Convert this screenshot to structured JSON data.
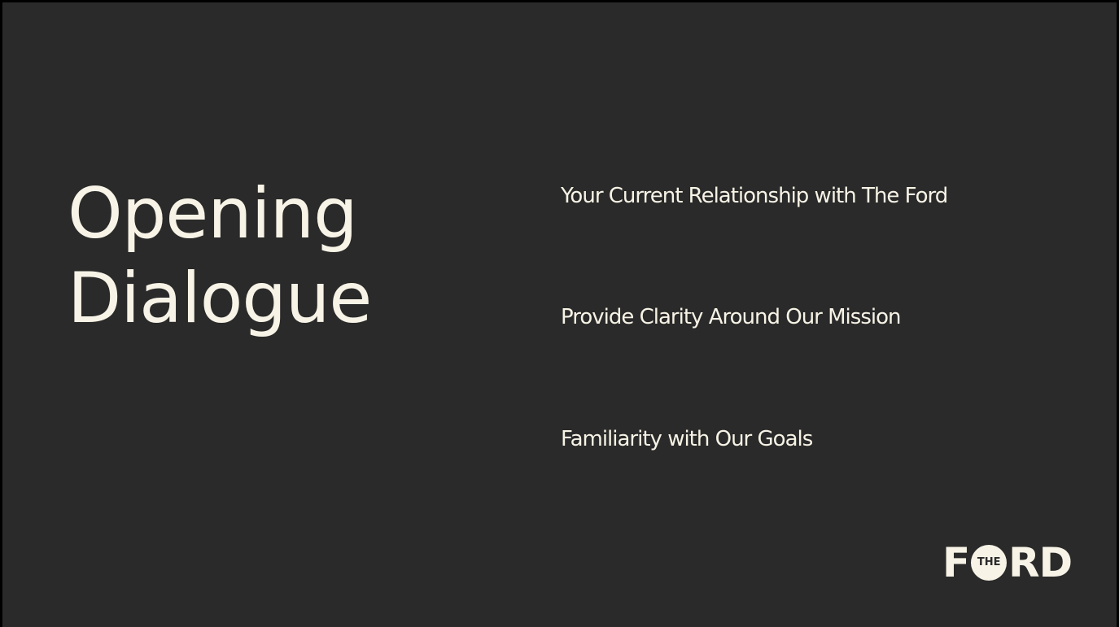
{
  "slide": {
    "title_line1": "Opening",
    "title_line2": "Dialogue",
    "topics": [
      "Your Current Relationship with The Ford",
      "Provide Clarity Around Our Mission",
      "Familiarity with Our Goals"
    ],
    "logo": {
      "letter_f": "F",
      "circle_text": "THE",
      "letters_rd": "RD"
    }
  },
  "colors": {
    "background": "#2a2a2a",
    "text": "#f7f3e6",
    "frame": "#000000"
  }
}
